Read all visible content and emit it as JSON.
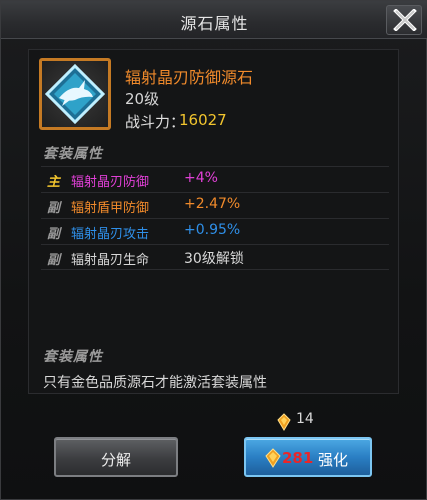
{
  "window": {
    "title": "源石属性"
  },
  "item": {
    "name": "辐射晶刃防御源石",
    "level": "20级",
    "power_label": "战斗力：",
    "power_value": "16027",
    "icon": "shark-crystal-icon"
  },
  "set_section": {
    "title": "套装属性",
    "rows": [
      {
        "tag": "主",
        "name": "辐射晶刃防御",
        "value": "+4%",
        "tag_color": "#f2c52e",
        "name_color": "#e040d6",
        "value_color": "#e040d6"
      },
      {
        "tag": "副",
        "name": "辐射盾甲防御",
        "value": "+2.47%",
        "tag_color": "#9a9a9a",
        "name_color": "#f08a2b",
        "value_color": "#f08a2b"
      },
      {
        "tag": "副",
        "name": "辐射晶刃攻击",
        "value": "+0.95%",
        "tag_color": "#9a9a9a",
        "name_color": "#2f8fe8",
        "value_color": "#2f8fe8"
      },
      {
        "tag": "副",
        "name": "辐射晶刃生命",
        "value": "30级解锁",
        "tag_color": "#9a9a9a",
        "name_color": "#d8d8d8",
        "value_color": "#d8d8d8"
      }
    ]
  },
  "set_bonus": {
    "title": "套装属性",
    "description": "只有金色品质源石才能激活套装属性"
  },
  "resources": {
    "owned": "14",
    "icon": "gold-crystal-icon"
  },
  "buttons": {
    "decompose": "分解",
    "enhance_cost": "281",
    "enhance": "强化"
  },
  "colors": {
    "accent_orange": "#f08a2b",
    "power_yellow": "#f2c52e",
    "button_blue": "#2a7fc4"
  }
}
